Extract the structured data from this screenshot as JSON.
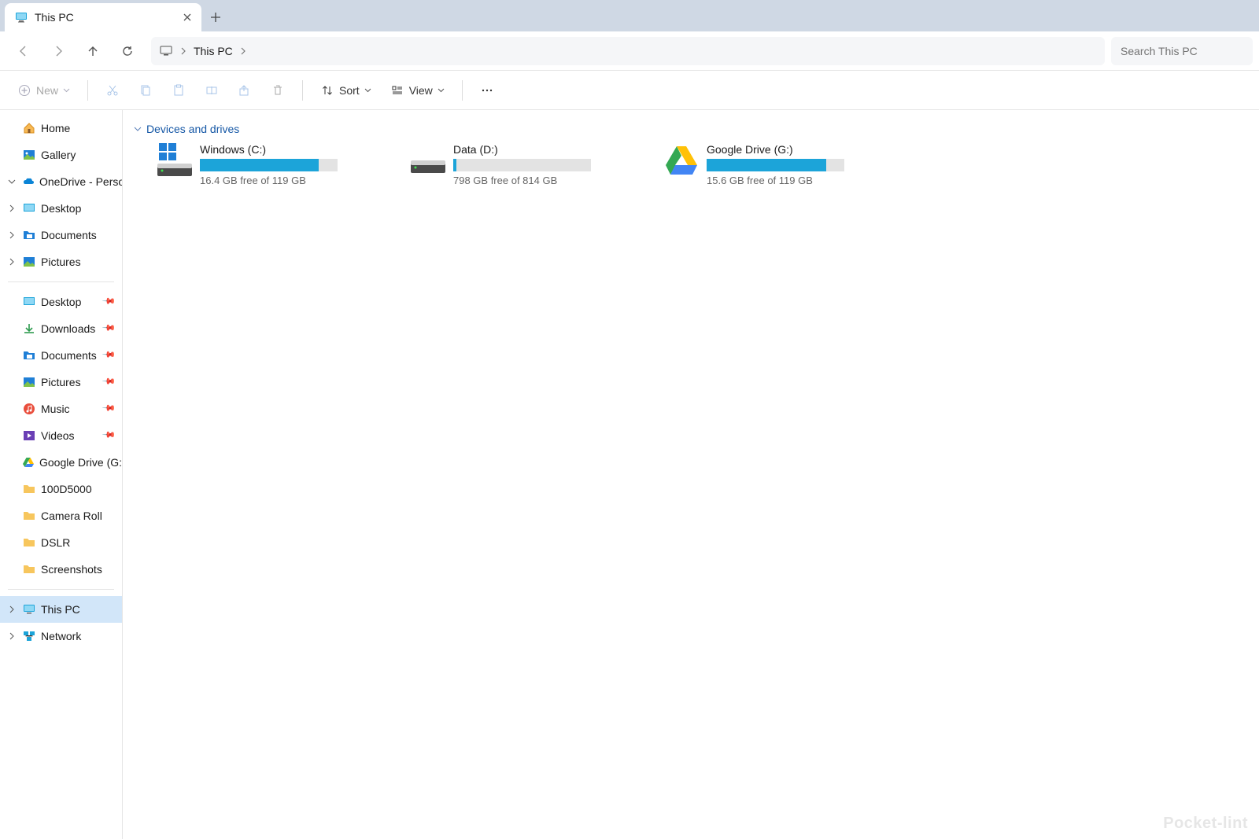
{
  "tab": {
    "title": "This PC"
  },
  "nav": {
    "address_segments": [
      "This PC"
    ],
    "search_placeholder": "Search This PC"
  },
  "toolbar": {
    "new_label": "New",
    "sort_label": "Sort",
    "view_label": "View"
  },
  "sidebar": {
    "top": [
      {
        "label": "Home",
        "icon": "home"
      },
      {
        "label": "Gallery",
        "icon": "gallery"
      },
      {
        "label": "OneDrive - Persona",
        "icon": "onedrive",
        "expandable": true,
        "expanded": true
      }
    ],
    "onedrive_children": [
      {
        "label": "Desktop",
        "icon": "desktop",
        "expandable": true
      },
      {
        "label": "Documents",
        "icon": "docfolder",
        "expandable": true
      },
      {
        "label": "Pictures",
        "icon": "picfolder",
        "expandable": true
      }
    ],
    "quick": [
      {
        "label": "Desktop",
        "icon": "desktop",
        "pinned": true
      },
      {
        "label": "Downloads",
        "icon": "downloads",
        "pinned": true
      },
      {
        "label": "Documents",
        "icon": "docfolder",
        "pinned": true
      },
      {
        "label": "Pictures",
        "icon": "picfolder",
        "pinned": true
      },
      {
        "label": "Music",
        "icon": "music",
        "pinned": true
      },
      {
        "label": "Videos",
        "icon": "videos",
        "pinned": true
      },
      {
        "label": "Google Drive (G:",
        "icon": "gdrive",
        "pinned": true
      },
      {
        "label": "100D5000",
        "icon": "folder"
      },
      {
        "label": "Camera Roll",
        "icon": "folder"
      },
      {
        "label": "DSLR",
        "icon": "folder"
      },
      {
        "label": "Screenshots",
        "icon": "folder"
      }
    ],
    "bottom": [
      {
        "label": "This PC",
        "icon": "thispc",
        "expandable": true,
        "selected": true
      },
      {
        "label": "Network",
        "icon": "network",
        "expandable": true
      }
    ]
  },
  "main": {
    "group_label": "Devices and drives",
    "drives": [
      {
        "name": "Windows (C:)",
        "free_text": "16.4 GB free of 119 GB",
        "used_pct": 86,
        "icon": "windisk"
      },
      {
        "name": "Data (D:)",
        "free_text": "798 GB free of 814 GB",
        "used_pct": 2,
        "icon": "disk"
      },
      {
        "name": "Google Drive (G:)",
        "free_text": "15.6 GB free of 119 GB",
        "used_pct": 87,
        "icon": "gdrive"
      }
    ]
  },
  "watermark": "Pocket-lint"
}
